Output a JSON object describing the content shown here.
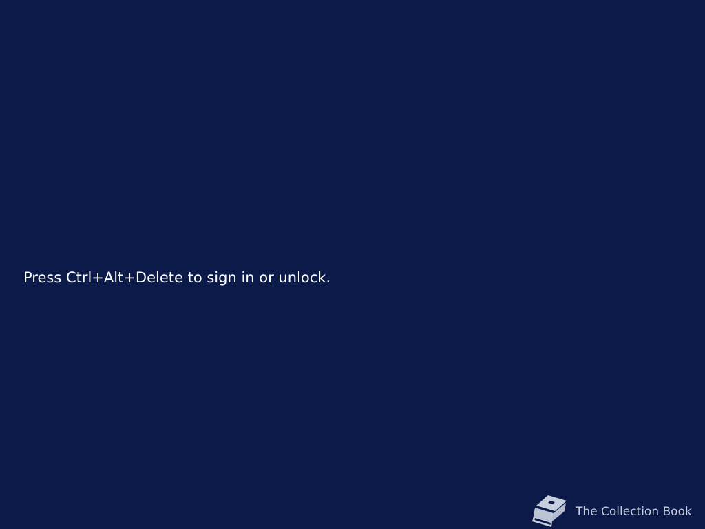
{
  "lock_screen": {
    "prompt": "Press Ctrl+Alt+Delete to sign in or unlock.",
    "background_color": "#0b1a48",
    "text_color": "#ffffff"
  },
  "branding": {
    "icon": "book-icon",
    "label": "The Collection Book",
    "color": "#c7cedd"
  }
}
